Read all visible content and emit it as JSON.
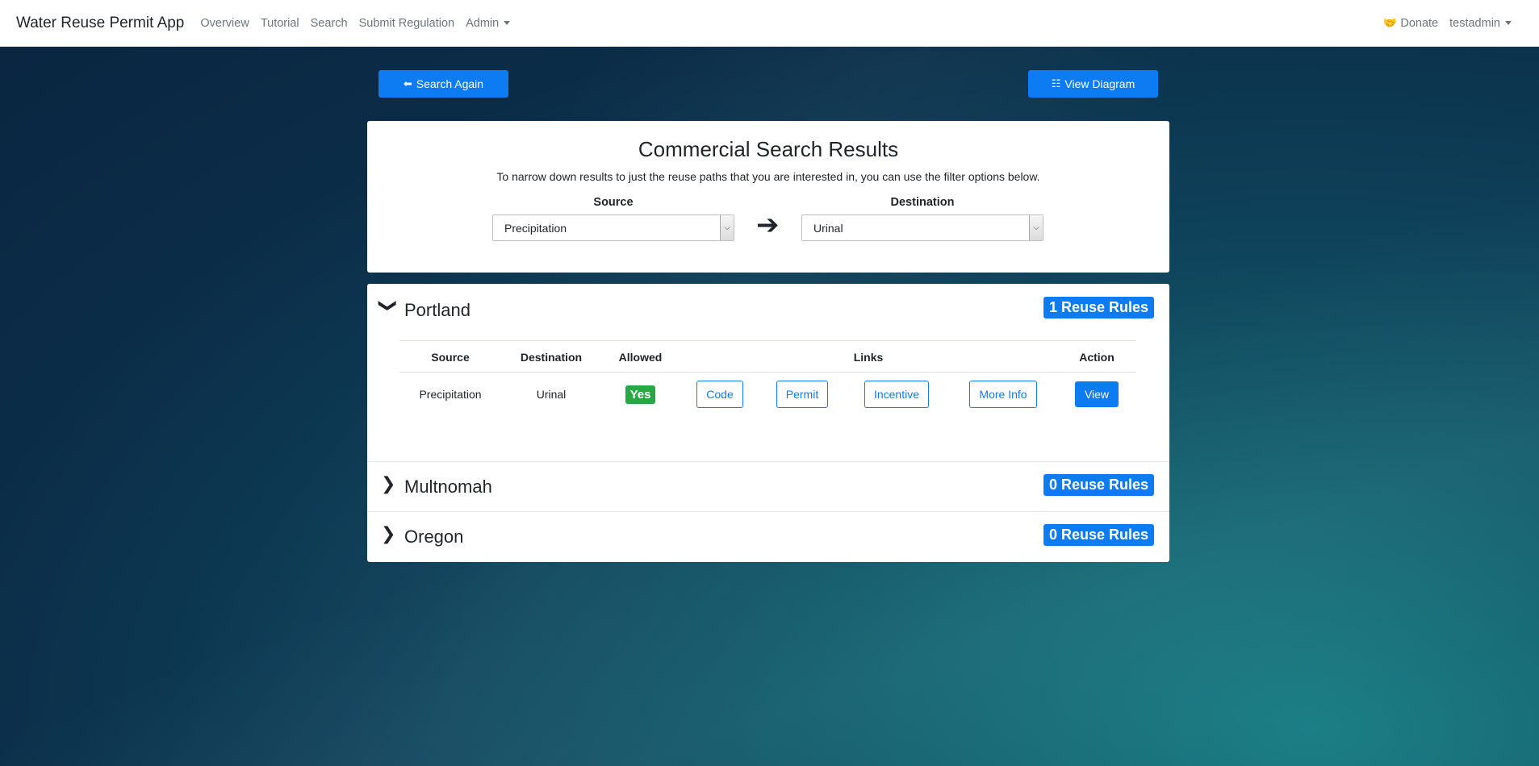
{
  "navbar": {
    "brand": "Water Reuse Permit App",
    "links": [
      "Overview",
      "Tutorial",
      "Search",
      "Submit Regulation",
      "Admin"
    ],
    "donate": "Donate",
    "user": "testadmin"
  },
  "actions": {
    "search_again": "Search Again",
    "view_diagram": "View Diagram"
  },
  "results": {
    "title": "Commercial Search Results",
    "subtitle": "To narrow down results to just the reuse paths that you are interested in, you can use the filter options below.",
    "source_label": "Source",
    "source_value": "Precipitation",
    "destination_label": "Destination",
    "destination_value": "Urinal"
  },
  "jurisdictions": [
    {
      "name": "Portland",
      "badge": "1 Reuse Rules",
      "expanded": true,
      "columns": [
        "Source",
        "Destination",
        "Allowed",
        "Links",
        "Action"
      ],
      "rows": [
        {
          "source": "Precipitation",
          "destination": "Urinal",
          "allowed": "Yes",
          "links": [
            "Code",
            "Permit",
            "Incentive",
            "More Info"
          ],
          "action": "View"
        }
      ]
    },
    {
      "name": "Multnomah",
      "badge": "0 Reuse Rules",
      "expanded": false
    },
    {
      "name": "Oregon",
      "badge": "0 Reuse Rules",
      "expanded": false
    }
  ],
  "colors": {
    "primary": "#0d7bf2",
    "success": "#28a745"
  }
}
